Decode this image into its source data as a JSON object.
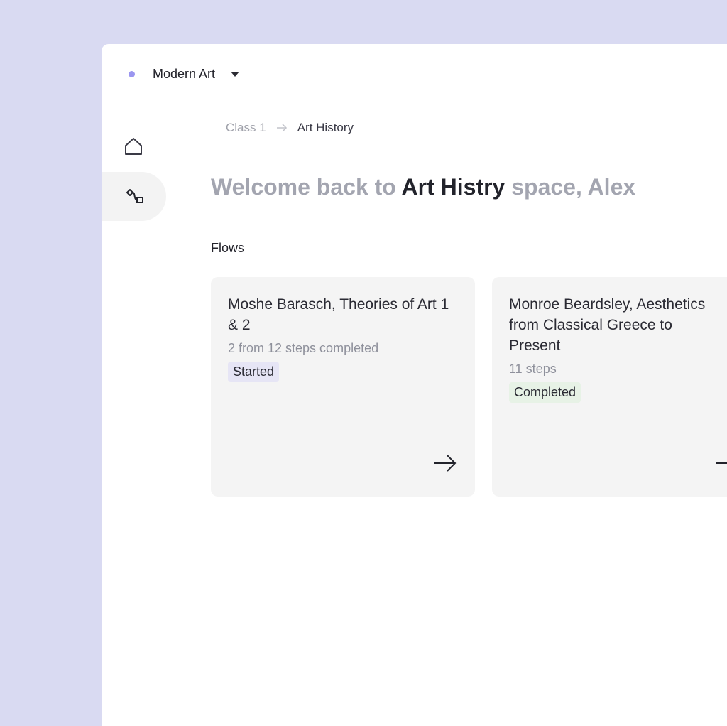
{
  "workspace": {
    "name": "Modern Art",
    "dot_color": "#9b96f0"
  },
  "nav": {
    "items": [
      {
        "icon": "home-icon",
        "active": false
      },
      {
        "icon": "flows-icon",
        "active": true
      }
    ]
  },
  "breadcrumb": {
    "items": [
      "Class 1",
      "Art History"
    ]
  },
  "welcome": {
    "prefix": "Welcome back to ",
    "space_name": "Art Histry",
    "suffix": " space, Alex"
  },
  "flows": {
    "title": "Flows",
    "cards": [
      {
        "title": "Moshe Barasch, Theories of Art 1 & 2",
        "meta": "2 from 12 steps completed",
        "status": "Started",
        "status_color": "#e6e5f5"
      },
      {
        "title_lines": [
          "Monroe Beardsley, Aesthetics",
          "from Classical Greece to",
          "Present"
        ],
        "meta": "11 steps",
        "status": "Completed",
        "status_color": "#e7f2e6"
      }
    ]
  }
}
